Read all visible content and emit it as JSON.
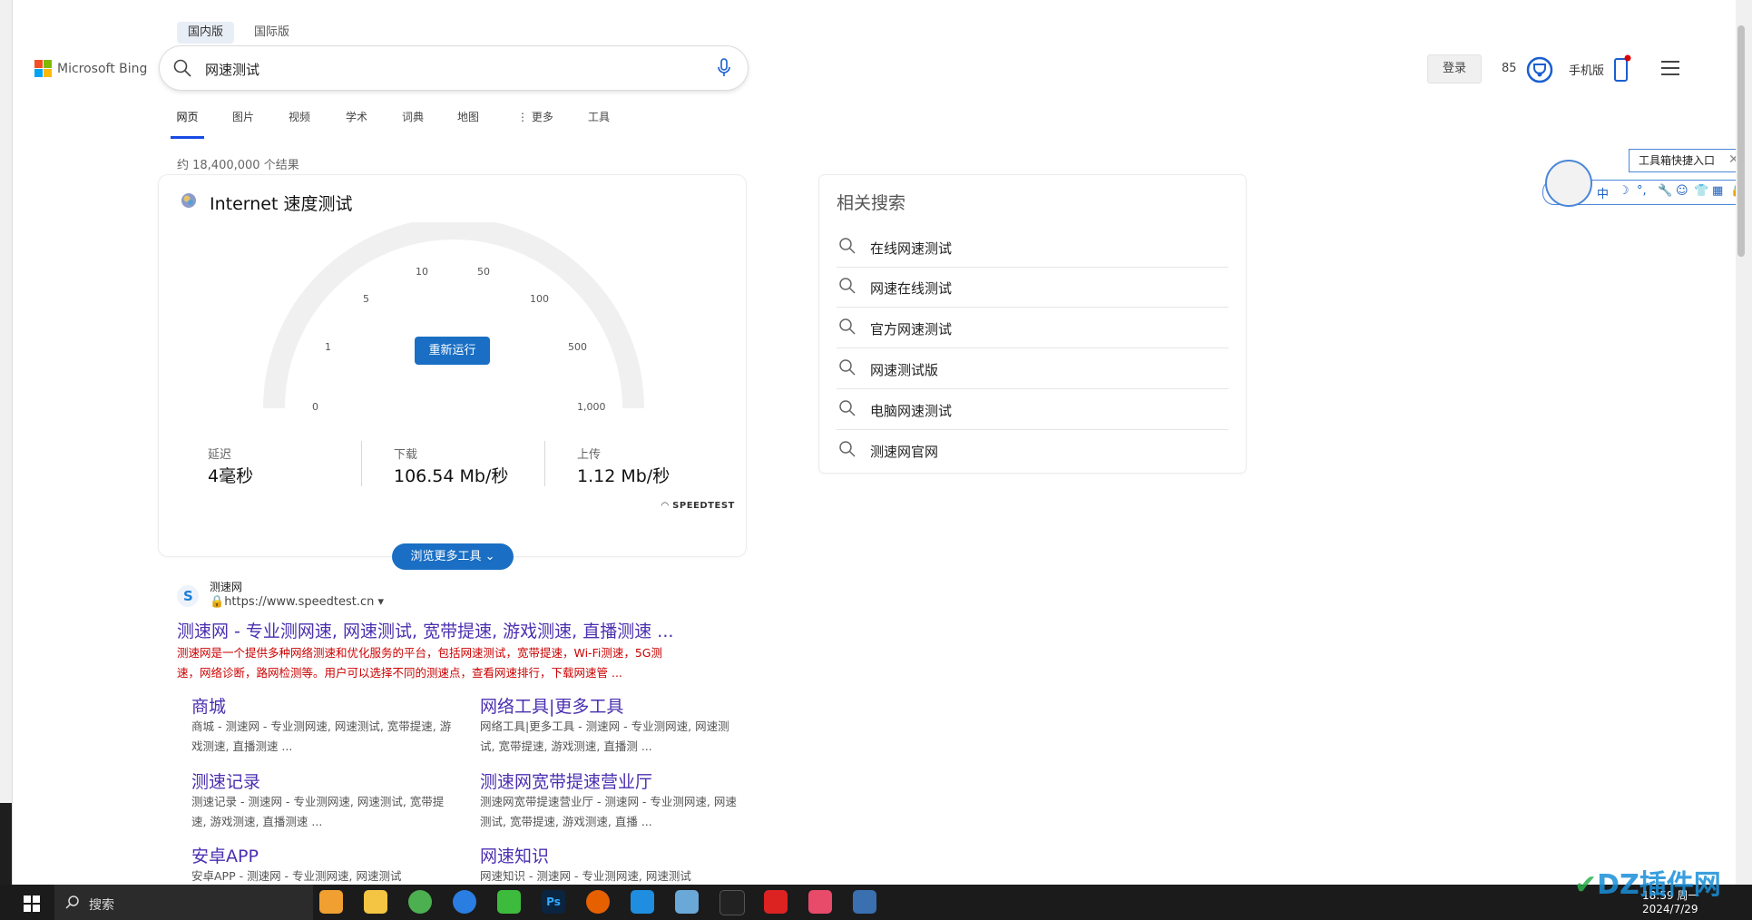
{
  "header": {
    "scope_tabs": [
      "国内版",
      "国际版"
    ],
    "logo_text": "Microsoft Bing",
    "search_value": "网速测试",
    "login_label": "登录",
    "points": "85",
    "mobile_label": "手机版"
  },
  "nav": {
    "items": [
      "网页",
      "图片",
      "视频",
      "学术",
      "词典",
      "地图",
      "更多",
      "工具"
    ],
    "active": "网页"
  },
  "result_count": "约 18,400,000 个结果",
  "speedtest": {
    "title": "Internet 速度测试",
    "ticks": [
      "0",
      "1",
      "5",
      "10",
      "50",
      "100",
      "500",
      "1,000"
    ],
    "rerun_label": "重新运行",
    "latency_label": "延迟",
    "latency_value": "4毫秒",
    "download_label": "下载",
    "download_value": "106.54 Mb/秒",
    "upload_label": "上传",
    "upload_value": "1.12 Mb/秒",
    "provider": "SPEEDTEST",
    "more_tools_label": "浏览更多工具"
  },
  "result": {
    "site_name": "测速网",
    "url": "https://www.speedtest.cn",
    "title": "测速网 - 专业测网速, 网速测试, 宽带提速, 游戏测速, 直播测速 ...",
    "snippet_line1": "测速网是一个提供多种网络测速和优化服务的平台，包括网速测试，宽带提速，Wi-Fi测速，5G测",
    "snippet_line2": "速，网络诊断，路网检测等。用户可以选择不同的测速点，查看网速排行，下载网速管 ...",
    "sitelinks": [
      {
        "title": "商城",
        "desc": "商城 - 测速网 - 专业测网速, 网速测试, 宽带提速, 游戏测速, 直播测速 ..."
      },
      {
        "title": "网络工具|更多工具",
        "desc": "网络工具|更多工具 - 测速网 - 专业测网速, 网速测试, 宽带提速, 游戏测速, 直播测 ..."
      },
      {
        "title": "测速记录",
        "desc": "测速记录 - 测速网 - 专业测网速, 网速测试, 宽带提速, 游戏测速, 直播测速 ..."
      },
      {
        "title": "测速网宽带提速营业厅",
        "desc": "测速网宽带提速营业厅 - 测速网 - 专业测网速, 网速测试, 宽带提速, 游戏测速, 直播 ..."
      },
      {
        "title": "安卓APP",
        "desc": "安卓APP - 测速网 - 专业测网速, 网速测试"
      },
      {
        "title": "网速知识",
        "desc": "网速知识 - 测速网 - 专业测网速, 网速测试"
      }
    ]
  },
  "related": {
    "heading": "相关搜索",
    "items": [
      "在线网速测试",
      "网速在线测试",
      "官方网速测试",
      "网速测试版",
      "电脑网速测试",
      "测速网官网"
    ]
  },
  "ime": {
    "tooltip": "工具箱快捷入口",
    "lang": "中"
  },
  "taskbar": {
    "search_label": "搜索",
    "time": "18:59 周一",
    "date": "2024/7/29"
  },
  "watermark": "DZ插件网",
  "colors": {
    "accent": "#1a6fc4",
    "link": "#4a2fb0",
    "snippet_red": "#cc0000"
  }
}
